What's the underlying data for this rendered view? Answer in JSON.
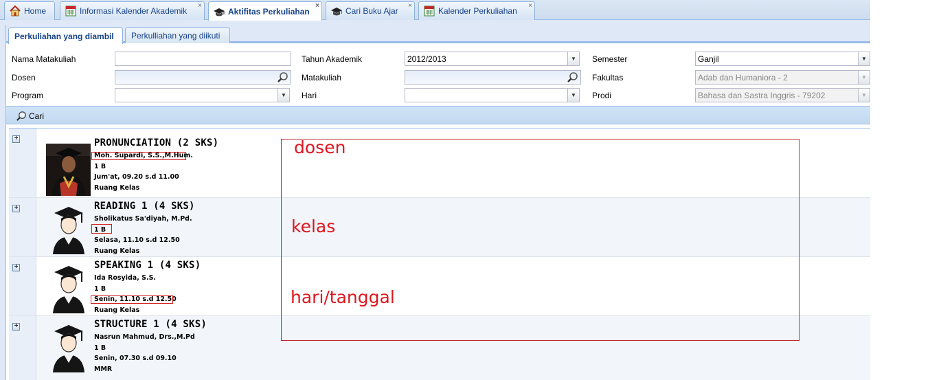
{
  "tabs": [
    {
      "label": "Home",
      "icon": "home-icon",
      "closable": false
    },
    {
      "label": "Informasi Kalender Akademik",
      "icon": "calendar-icon",
      "closable": true
    },
    {
      "label": "Aktifitas Perkuliahan",
      "icon": "graduation-cap-icon",
      "closable": true,
      "active": true
    },
    {
      "label": "Cari Buku Ajar",
      "icon": "graduation-cap-icon",
      "closable": true
    },
    {
      "label": "Kalender Perkuliahan",
      "icon": "calendar-icon",
      "closable": true
    }
  ],
  "subtabs": [
    {
      "label": "Perkuliahan yang diambil",
      "active": true
    },
    {
      "label": "Perkulliahan yang diikuti"
    }
  ],
  "form": {
    "nama_matakuliah": {
      "label": "Nama Matakuliah",
      "value": ""
    },
    "dosen": {
      "label": "Dosen",
      "value": ""
    },
    "program": {
      "label": "Program",
      "value": ""
    },
    "tahun_akademik": {
      "label": "Tahun Akademik",
      "value": "2012/2013"
    },
    "matakuliah": {
      "label": "Matakuliah",
      "value": ""
    },
    "hari": {
      "label": "Hari",
      "value": ""
    },
    "semester": {
      "label": "Semester",
      "value": "Ganjil"
    },
    "fakultas": {
      "label": "Fakultas",
      "value": "Adab dan Humaniora - 2"
    },
    "prodi": {
      "label": "Prodi",
      "value": "Bahasa dan Sastra Inggris - 79202"
    }
  },
  "toolbar": {
    "search_label": "Cari"
  },
  "courses": [
    {
      "title": "PRONUNCIATION (2 SKS)",
      "dosen": "Moh. Supardi, S.S.,M.Hum.",
      "kelas": "1 B",
      "jadwal": "Jum'at, 09.20 s.d 11.00",
      "ruang": "Ruang Kelas",
      "avatar": "person-photo"
    },
    {
      "title": "READING 1 (4 SKS)",
      "dosen": "Sholikatus Sa'diyah, M.Pd.",
      "kelas": "1 B",
      "jadwal": "Selasa, 11.10 s.d 12.50",
      "ruang": "Ruang Kelas",
      "avatar": "graduate-avatar-icon"
    },
    {
      "title": "SPEAKING 1 (4 SKS)",
      "dosen": "Ida Rosyida, S.S.",
      "kelas": "1 B",
      "jadwal": "Senin, 11.10 s.d 12.50",
      "ruang": "Ruang Kelas",
      "avatar": "graduate-avatar-icon"
    },
    {
      "title": "STRUCTURE 1 (4 SKS)",
      "dosen": "Nasrun Mahmud, Drs.,M.Pd",
      "kelas": "1 B",
      "jadwal": "Senin, 07.30 s.d 09.10",
      "ruang": "MMR",
      "avatar": "graduate-avatar-icon"
    }
  ],
  "annotations": {
    "dosen": "dosen",
    "kelas": "kelas",
    "hari": "hari/tanggal",
    "color": "#e0161e"
  }
}
